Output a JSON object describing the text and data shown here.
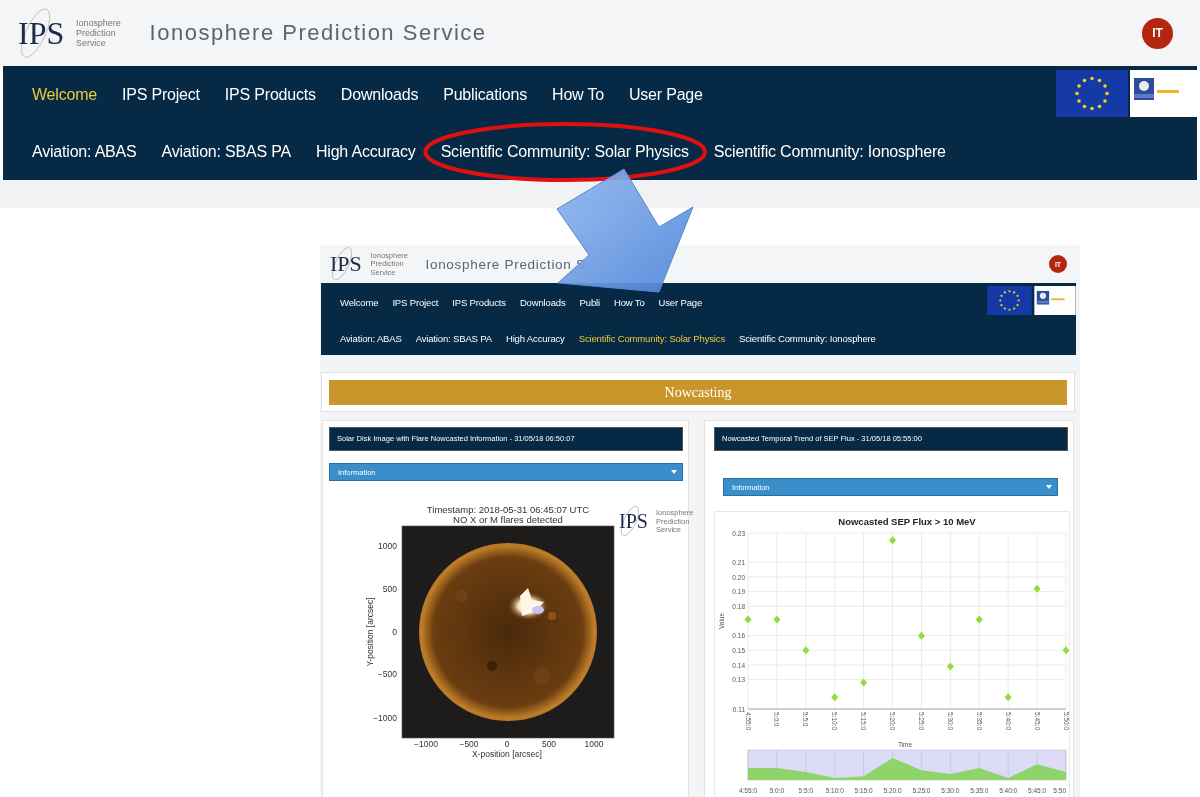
{
  "site": {
    "logo": {
      "letters": "IPS",
      "caption": [
        "Ionosphere",
        "Prediction",
        "Service"
      ]
    },
    "title": "Ionosphere Prediction Service",
    "avatar": "IT",
    "menu": [
      {
        "label": "Welcome",
        "selected": true
      },
      {
        "label": "IPS Project",
        "selected": false
      },
      {
        "label": "IPS Products",
        "selected": false
      },
      {
        "label": "Downloads",
        "selected": false
      },
      {
        "label": "Publications",
        "selected": false
      },
      {
        "label": "How To",
        "selected": false
      },
      {
        "label": "User Page",
        "selected": false
      }
    ],
    "submenu": [
      {
        "label": "Aviation: ABAS",
        "selected": false,
        "highlighted": false
      },
      {
        "label": "Aviation: SBAS PA",
        "selected": false,
        "highlighted": false
      },
      {
        "label": "High Accuracy",
        "selected": false,
        "highlighted": false
      },
      {
        "label": "Scientific Community: Solar Physics",
        "selected": false,
        "highlighted": true
      },
      {
        "label": "Scientific Community: Ionosphere",
        "selected": false,
        "highlighted": false
      }
    ]
  },
  "inset": {
    "logo": {
      "letters": "IPS",
      "caption": [
        "Ionosphere",
        "Prediction",
        "Service"
      ]
    },
    "title": "Ionosphere Prediction S",
    "avatar": "IT",
    "menu": [
      {
        "label": "Welcome",
        "selected": false
      },
      {
        "label": "IPS Project",
        "selected": false
      },
      {
        "label": "IPS Products",
        "selected": false
      },
      {
        "label": "Downloads",
        "selected": false
      },
      {
        "label": "Publi",
        "selected": false
      },
      {
        "label": "How To",
        "selected": false
      },
      {
        "label": "User Page",
        "selected": false
      }
    ],
    "submenu": [
      {
        "label": "Aviation: ABAS",
        "selected": false,
        "highlighted": false
      },
      {
        "label": "Aviation: SBAS PA",
        "selected": false,
        "highlighted": false
      },
      {
        "label": "High Accuracy",
        "selected": false,
        "highlighted": false
      },
      {
        "label": "Scientific Community: Solar Physics",
        "selected": true,
        "highlighted": false
      },
      {
        "label": "Scientific Community: Ionosphere",
        "selected": false,
        "highlighted": false
      }
    ],
    "section": "Nowcasting",
    "left_panel": {
      "title": "Solar Disk Image with Flare Nowcasted Information - 31/05/18 06:50:07",
      "dropdown": "Information",
      "plot": {
        "title_lines": [
          "Timestamp: 2018-05-31 06:45:07 UTC",
          "NO X or M flares detected"
        ],
        "yticks": [
          "1000",
          "500",
          "0",
          "−500",
          "−1000"
        ],
        "xticks": [
          "−1000",
          "−500",
          "0",
          "500",
          "1000"
        ],
        "xlabel": "X-position [arcsec]",
        "ylabel": "Y-position [arcsec]",
        "logo": {
          "letters": "IPS",
          "caption": [
            "Ionosphere",
            "Prediction",
            "Service"
          ]
        }
      }
    },
    "right_panel": {
      "title": "Nowcasted Temporal Trend of SEP Flux - 31/05/18 05:55:00",
      "dropdown": "Information",
      "chart_data": {
        "type": "scatter",
        "title": "Nowcasted SEP Flux > 10 MeV",
        "xlabel": "Time",
        "ylabel": "Value",
        "grid": true,
        "categories": [
          "4:55:0",
          "5:0:0",
          "5:5:0",
          "5:10:0",
          "5:15:0",
          "5:20:0",
          "5:25:0",
          "5:30:0",
          "5:35:0",
          "5:40:0",
          "5:45:0",
          "5:50:0"
        ],
        "series": [
          {
            "color": "#8fdc3c",
            "values": [
              0.171,
              0.171,
              0.15,
              0.118,
              0.128,
              0.225,
              0.16,
              0.139,
              0.171,
              0.118,
              0.192,
              0.15
            ]
          }
        ],
        "ylim": [
          0.11,
          0.23
        ],
        "yticks": [
          {
            "value": 0.11,
            "label": "0.11"
          },
          {
            "value": 0.13,
            "label": "0.13"
          },
          {
            "value": 0.14,
            "label": "0.14"
          },
          {
            "value": 0.15,
            "label": "0.15"
          },
          {
            "value": 0.16,
            "label": "0.16"
          },
          {
            "value": 0.18,
            "label": "0.18"
          },
          {
            "value": 0.19,
            "label": "0.19"
          },
          {
            "value": 0.2,
            "label": "0.20"
          },
          {
            "value": 0.21,
            "label": "0.21"
          },
          {
            "value": 0.23,
            "label": "0.23"
          }
        ]
      },
      "navigator_labels": [
        "4:55:0",
        "5:0:0",
        "5:5:0",
        "5:10:0",
        "5:15:0",
        "5:20:0",
        "5:25:0",
        "5:30:0",
        "5:35:0",
        "5:40:0",
        "5:45:0",
        "5:50"
      ]
    }
  }
}
